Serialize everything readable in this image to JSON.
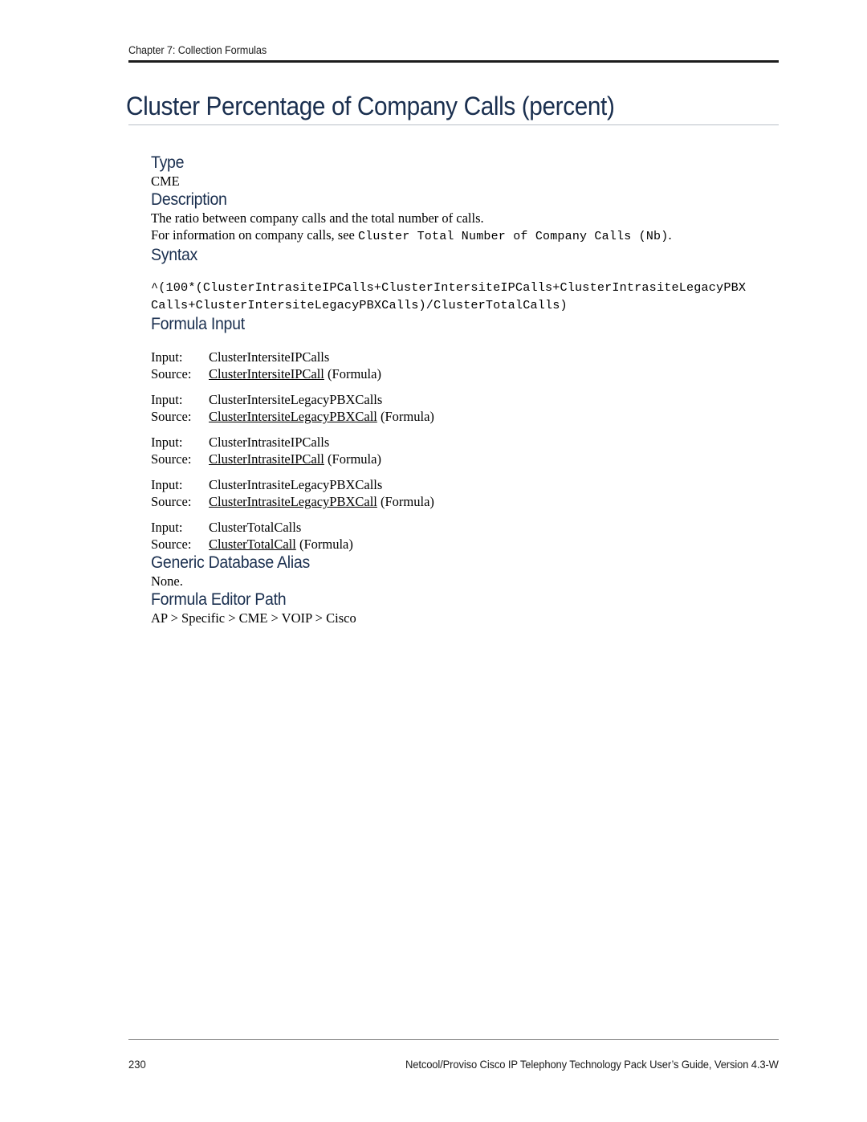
{
  "header": {
    "chapter_label": "Chapter 7:  Collection Formulas"
  },
  "title": "Cluster Percentage of Company Calls (percent)",
  "sections": {
    "type": {
      "heading": "Type",
      "value": "CME"
    },
    "description": {
      "heading": "Description",
      "paragraph1": "The ratio between company calls and the total number of calls.",
      "paragraph2_prefix": "For information on company calls, see ",
      "paragraph2_code": "Cluster Total Number of Company Calls (Nb)",
      "paragraph2_suffix": "."
    },
    "syntax": {
      "heading": "Syntax",
      "line1": "^(100*(ClusterIntrasiteIPCalls+ClusterIntersiteIPCalls+ClusterIntrasiteLegacyPBX",
      "line2": "Calls+ClusterIntersiteLegacyPBXCalls)/ClusterTotalCalls)"
    },
    "formula_input": {
      "heading": "Formula Input",
      "input_label": "Input:",
      "source_label": "Source:",
      "source_suffix": " (Formula)",
      "entries": [
        {
          "input": "ClusterIntersiteIPCalls",
          "source_link": "ClusterIntersiteIPCall"
        },
        {
          "input": "ClusterIntersiteLegacyPBXCalls",
          "source_link": "ClusterIntersiteLegacyPBXCall"
        },
        {
          "input": "ClusterIntrasiteIPCalls",
          "source_link": "ClusterIntrasiteIPCall"
        },
        {
          "input": "ClusterIntrasiteLegacyPBXCalls",
          "source_link": "ClusterIntrasiteLegacyPBXCall"
        },
        {
          "input": "ClusterTotalCalls",
          "source_link": "ClusterTotalCall"
        }
      ]
    },
    "generic_database_alias": {
      "heading": "Generic Database Alias",
      "value": "None."
    },
    "formula_editor_path": {
      "heading": "Formula Editor Path",
      "value": "AP > Specific > CME > VOIP > Cisco"
    }
  },
  "footer": {
    "page_number": "230",
    "document_title": "Netcool/Proviso Cisco IP Telephony Technology Pack User’s Guide, Version 4.3-W"
  },
  "colors": {
    "heading_navy": "#1a2f4f",
    "header_rule": "#1c1c1c",
    "title_rule": "#b9bfc7",
    "footer_rule": "#7f7f7f",
    "body_text": "#000000"
  }
}
